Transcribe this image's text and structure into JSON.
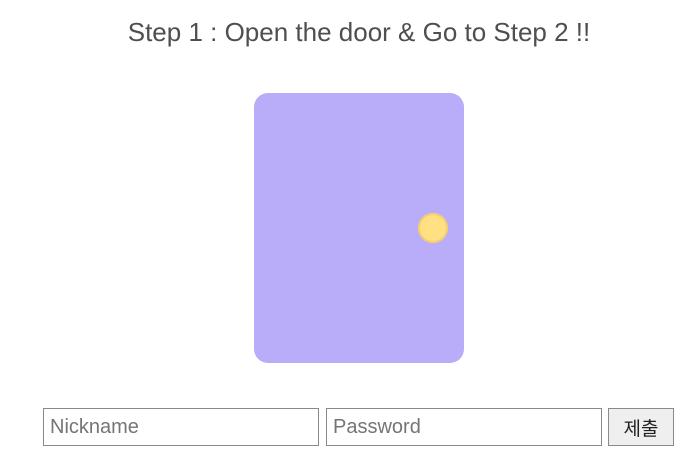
{
  "page": {
    "title": "Step 1 : Open the door & Go to Step 2 !!"
  },
  "door": {
    "icon": "door-icon",
    "knob_icon": "door-knob-icon",
    "color": "#b9acf8",
    "knob_color": "#ffe082",
    "knob_border_color": "#f6cf6a"
  },
  "form": {
    "nickname": {
      "placeholder": "Nickname",
      "value": ""
    },
    "password": {
      "placeholder": "Password",
      "value": ""
    },
    "submit_label": "제출"
  }
}
